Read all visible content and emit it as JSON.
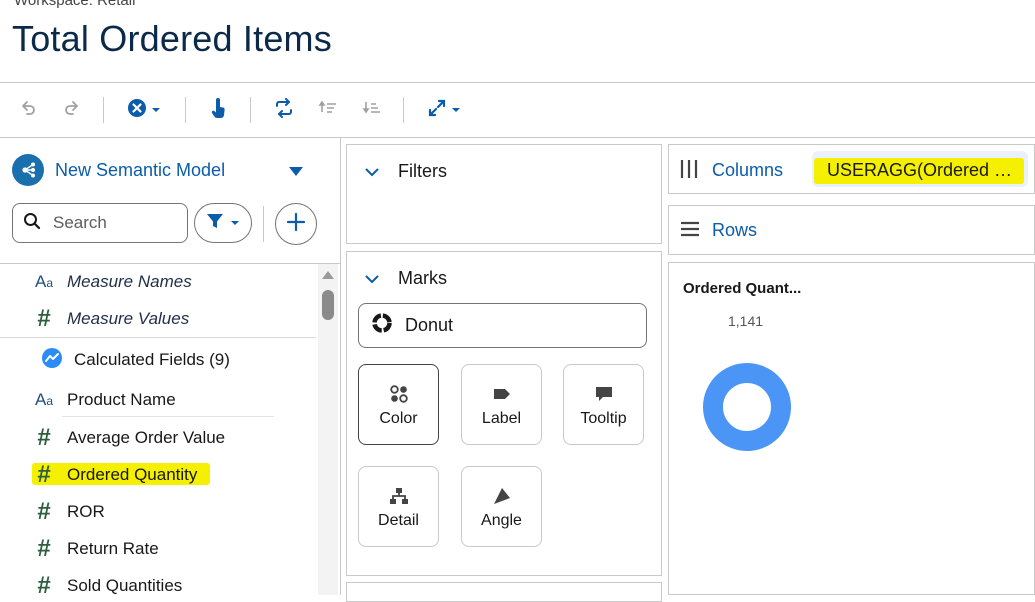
{
  "header": {
    "breadcrumb": "Workspace: Retail",
    "title": "Total Ordered Items"
  },
  "toolbar": {
    "icons": [
      "undo-icon",
      "redo-icon",
      "clear-icon",
      "touch-icon",
      "swap-icon",
      "sort-ascending-icon",
      "sort-descending-icon",
      "fit-icon"
    ]
  },
  "sidebar": {
    "model_name": "New Semantic Model",
    "search_placeholder": "Search",
    "fields": [
      {
        "label": "Measure Names",
        "type": "text",
        "italic": true
      },
      {
        "label": "Measure Values",
        "type": "number",
        "italic": true
      },
      {
        "label": "Calculated Fields (9)",
        "type": "calc"
      },
      {
        "label": "Product Name",
        "type": "text"
      },
      {
        "label": "Average Order Value",
        "type": "number"
      },
      {
        "label": "Ordered Quantity",
        "type": "number",
        "highlighted": true
      },
      {
        "label": "ROR",
        "type": "number"
      },
      {
        "label": "Return Rate",
        "type": "number"
      },
      {
        "label": "Sold Quantities",
        "type": "number"
      }
    ]
  },
  "filters": {
    "title": "Filters"
  },
  "marks": {
    "title": "Marks",
    "mark_type": "Donut",
    "buttons": [
      {
        "label": "Color",
        "selected": true
      },
      {
        "label": "Label"
      },
      {
        "label": "Tooltip"
      },
      {
        "label": "Detail"
      },
      {
        "label": "Angle"
      }
    ]
  },
  "shelves": {
    "columns_label": "Columns",
    "columns_pill": "USERAGG(Ordered Qu...",
    "rows_label": "Rows"
  },
  "viz": {
    "title": "Ordered Quant...",
    "value": "1,141",
    "donut_color": "#4a95f5"
  },
  "colors": {
    "accent": "#0b5cab",
    "highlight": "#f4f000"
  }
}
